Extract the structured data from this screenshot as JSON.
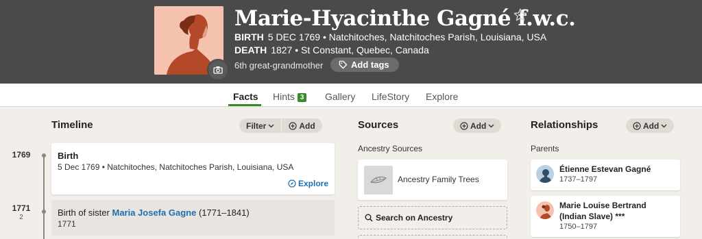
{
  "header": {
    "name": "Marie-Hyacinthe Gagné f.w.c.",
    "birth_label": "BIRTH",
    "birth_value": "5 DEC 1769 • Natchitoches, Natchitoches Parish, Louisiana, USA",
    "death_label": "DEATH",
    "death_value": "1827 • St Constant, Quebec, Canada",
    "relation": "6th great-grandmother",
    "add_tags_label": "Add tags",
    "icons": [
      "camera-icon",
      "star-icon",
      "tag-icon"
    ],
    "portrait_colors": {
      "bg": "#f4c2ae",
      "figure": "#b4492a"
    }
  },
  "tabs": [
    {
      "label": "Facts",
      "active": true
    },
    {
      "label": "Hints",
      "badge": "3"
    },
    {
      "label": "Gallery"
    },
    {
      "label": "LifeStory"
    },
    {
      "label": "Explore"
    }
  ],
  "timeline": {
    "title": "Timeline",
    "filter_label": "Filter",
    "add_label": "Add",
    "events": [
      {
        "year": "1769",
        "title": "Birth",
        "detail": "5 Dec 1769 • Natchitoches, Natchitoches Parish, Louisiana, USA",
        "action": "Explore"
      },
      {
        "year": "1771",
        "age": "2",
        "title_prefix": "Birth of sister",
        "person": "Maria Josefa Gagne",
        "person_dates": "(1771–1841)",
        "detail": "1771"
      }
    ]
  },
  "sources": {
    "title": "Sources",
    "add_label": "Add",
    "group_label": "Ancestry Sources",
    "items": [
      {
        "label": "Ancestry Family Trees"
      }
    ],
    "search_label": "Search on Ancestry"
  },
  "relationships": {
    "title": "Relationships",
    "add_label": "Add",
    "group_label": "Parents",
    "parents": [
      {
        "name": "Étienne Estevan Gagné",
        "dates": "1737–1797"
      },
      {
        "name_line1": "Marie Louise Bertrand",
        "name_line2": "(Indian Slave) ***",
        "dates": "1750–1797"
      }
    ]
  },
  "colors": {
    "accent_green": "#3a8a2e",
    "link_blue": "#1e6fb0",
    "header_bg": "#4a4a4a"
  }
}
